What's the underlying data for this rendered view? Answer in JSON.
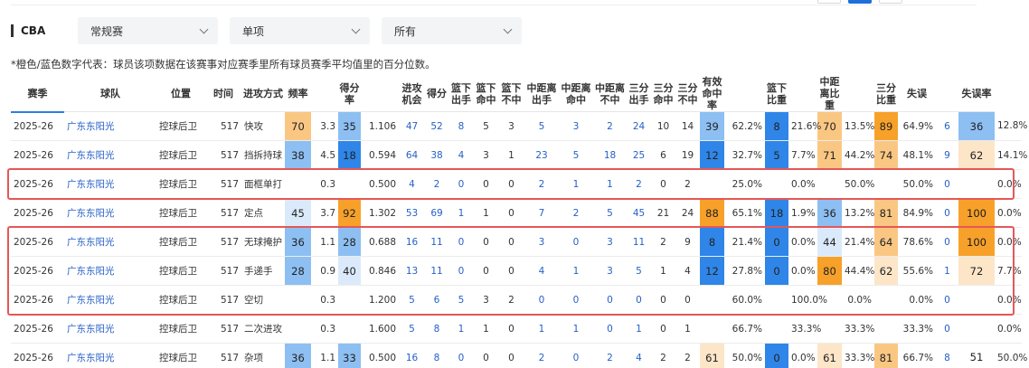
{
  "top_controls": [
    {
      "active": false
    },
    {
      "active": true
    },
    {
      "active": false
    }
  ],
  "league_label": "CBA",
  "filters": [
    {
      "label": "常规赛",
      "icon": "chevron-down-icon"
    },
    {
      "label": "单项",
      "icon": "chevron-down-icon"
    },
    {
      "label": "所有",
      "icon": "chevron-down-icon"
    }
  ],
  "note": "*橙色/蓝色数字代表：球员该项数据在该赛事对应赛季里所有球员赛季平均值里的百分位数。",
  "colors": {
    "blue_dark": "#2f86e8",
    "blue_mid": "#8dbff2",
    "blue_light": "#dbeafb",
    "orange_dark": "#f7a12a",
    "orange_mid": "#fac783",
    "orange_light": "#fde5c8",
    "link": "#2660c6",
    "highlight_border": "#e55757"
  },
  "columns": [
    "赛季",
    "球队",
    "位置",
    "时间",
    "进攻方式",
    "频率",
    "",
    "得分率",
    "",
    "进攻机会",
    "得分",
    "篮下出手",
    "篮下命中",
    "篮下不中",
    "中距离出手",
    "中距离命中",
    "中距离不中",
    "三分出手",
    "三分命中",
    "三分不中",
    "有效命中率",
    "",
    "篮下比重",
    "",
    "中距离比重",
    "",
    "三分比重",
    "失误",
    "",
    "失误率"
  ],
  "rows": [
    {
      "season": "2025-26",
      "team": "广东东阳光",
      "pos": "控球后卫",
      "time": "517",
      "type": "快攻",
      "freq_pct": "70",
      "freq_tone": "orange_mid",
      "freq": "3.3",
      "ppp_pct": "35",
      "ppp_tone": "blue_mid",
      "ppp": "1.106",
      "poss": "47",
      "pts": "52",
      "rim_att": "8",
      "rim_made": "5",
      "rim_miss": "3",
      "mid_att": "5",
      "mid_made": "3",
      "mid_miss": "2",
      "three_att": "24",
      "three_made": "10",
      "three_miss": "14",
      "efg_pct": "39",
      "efg_tone": "blue_mid",
      "efg": "62.2%",
      "rim_share_pct": "8",
      "rim_share_tone": "blue_dark",
      "rim_share": "21.6%",
      "mid_share_pct": "70",
      "mid_share_tone": "orange_mid",
      "mid_share": "13.5%",
      "three_share_pct": "89",
      "three_share_tone": "orange_dark",
      "three_share": "64.9%",
      "tov": "6",
      "tov_pct": "36",
      "tov_tone": "blue_mid",
      "tov_rate": "12.8%"
    },
    {
      "season": "2025-26",
      "team": "广东东阳光",
      "pos": "控球后卫",
      "time": "517",
      "type": "挡拆持球",
      "freq_pct": "38",
      "freq_tone": "blue_mid",
      "freq": "4.5",
      "ppp_pct": "18",
      "ppp_tone": "blue_dark",
      "ppp": "0.594",
      "poss": "64",
      "pts": "38",
      "rim_att": "4",
      "rim_made": "3",
      "rim_miss": "1",
      "mid_att": "23",
      "mid_made": "5",
      "mid_miss": "18",
      "three_att": "25",
      "three_made": "6",
      "three_miss": "19",
      "efg_pct": "12",
      "efg_tone": "blue_dark",
      "efg": "32.7%",
      "rim_share_pct": "5",
      "rim_share_tone": "blue_dark",
      "rim_share": "7.7%",
      "mid_share_pct": "71",
      "mid_share_tone": "orange_mid",
      "mid_share": "44.2%",
      "three_share_pct": "74",
      "three_share_tone": "orange_mid",
      "three_share": "48.1%",
      "tov": "9",
      "tov_pct": "62",
      "tov_tone": "orange_light",
      "tov_rate": "14.1%"
    },
    {
      "season": "2025-26",
      "team": "广东东阳光",
      "pos": "控球后卫",
      "time": "517",
      "type": "面框单打",
      "freq_pct": "",
      "freq_tone": "",
      "freq": "0.3",
      "ppp_pct": "",
      "ppp_tone": "",
      "ppp": "0.500",
      "poss": "4",
      "pts": "2",
      "rim_att": "0",
      "rim_made": "0",
      "rim_miss": "0",
      "mid_att": "2",
      "mid_made": "1",
      "mid_miss": "1",
      "three_att": "2",
      "three_made": "0",
      "three_miss": "2",
      "efg_pct": "",
      "efg_tone": "",
      "efg": "25.0%",
      "rim_share_pct": "",
      "rim_share_tone": "",
      "rim_share": "0.0%",
      "mid_share_pct": "",
      "mid_share_tone": "",
      "mid_share": "50.0%",
      "three_share_pct": "",
      "three_share_tone": "",
      "three_share": "50.0%",
      "tov": "0",
      "tov_pct": "",
      "tov_tone": "",
      "tov_rate": "0.0%"
    },
    {
      "season": "2025-26",
      "team": "广东东阳光",
      "pos": "控球后卫",
      "time": "517",
      "type": "定点",
      "freq_pct": "45",
      "freq_tone": "blue_light",
      "freq": "3.7",
      "ppp_pct": "92",
      "ppp_tone": "orange_dark",
      "ppp": "1.302",
      "poss": "53",
      "pts": "69",
      "rim_att": "1",
      "rim_made": "1",
      "rim_miss": "0",
      "mid_att": "7",
      "mid_made": "2",
      "mid_miss": "5",
      "three_att": "45",
      "three_made": "21",
      "three_miss": "24",
      "efg_pct": "88",
      "efg_tone": "orange_dark",
      "efg": "65.1%",
      "rim_share_pct": "18",
      "rim_share_tone": "blue_dark",
      "rim_share": "1.9%",
      "mid_share_pct": "36",
      "mid_share_tone": "blue_mid",
      "mid_share": "13.2%",
      "three_share_pct": "81",
      "three_share_tone": "orange_mid",
      "three_share": "84.9%",
      "tov": "0",
      "tov_pct": "100",
      "tov_tone": "orange_dark",
      "tov_rate": "0.0%"
    },
    {
      "season": "2025-26",
      "team": "广东东阳光",
      "pos": "控球后卫",
      "time": "517",
      "type": "无球掩护",
      "freq_pct": "36",
      "freq_tone": "blue_mid",
      "freq": "1.1",
      "ppp_pct": "28",
      "ppp_tone": "blue_mid",
      "ppp": "0.688",
      "poss": "16",
      "pts": "11",
      "rim_att": "0",
      "rim_made": "0",
      "rim_miss": "0",
      "mid_att": "3",
      "mid_made": "0",
      "mid_miss": "3",
      "three_att": "11",
      "three_made": "2",
      "three_miss": "9",
      "efg_pct": "8",
      "efg_tone": "blue_dark",
      "efg": "21.4%",
      "rim_share_pct": "0",
      "rim_share_tone": "blue_dark",
      "rim_share": "0.0%",
      "mid_share_pct": "44",
      "mid_share_tone": "blue_light",
      "mid_share": "21.4%",
      "three_share_pct": "64",
      "three_share_tone": "orange_mid",
      "three_share": "78.6%",
      "tov": "0",
      "tov_pct": "100",
      "tov_tone": "orange_dark",
      "tov_rate": "0.0%"
    },
    {
      "season": "2025-26",
      "team": "广东东阳光",
      "pos": "控球后卫",
      "time": "517",
      "type": "手递手",
      "freq_pct": "28",
      "freq_tone": "blue_mid",
      "freq": "0.9",
      "ppp_pct": "40",
      "ppp_tone": "blue_light",
      "ppp": "0.846",
      "poss": "13",
      "pts": "11",
      "rim_att": "0",
      "rim_made": "0",
      "rim_miss": "0",
      "mid_att": "4",
      "mid_made": "1",
      "mid_miss": "3",
      "three_att": "5",
      "three_made": "1",
      "three_miss": "4",
      "efg_pct": "12",
      "efg_tone": "blue_dark",
      "efg": "27.8%",
      "rim_share_pct": "0",
      "rim_share_tone": "blue_dark",
      "rim_share": "0.0%",
      "mid_share_pct": "80",
      "mid_share_tone": "orange_dark",
      "mid_share": "44.4%",
      "three_share_pct": "62",
      "three_share_tone": "orange_light",
      "three_share": "55.6%",
      "tov": "1",
      "tov_pct": "72",
      "tov_tone": "orange_light",
      "tov_rate": "7.7%"
    },
    {
      "season": "2025-26",
      "team": "广东东阳光",
      "pos": "控球后卫",
      "time": "517",
      "type": "空切",
      "freq_pct": "",
      "freq_tone": "",
      "freq": "0.3",
      "ppp_pct": "",
      "ppp_tone": "",
      "ppp": "1.200",
      "poss": "5",
      "pts": "6",
      "rim_att": "5",
      "rim_made": "3",
      "rim_miss": "2",
      "mid_att": "0",
      "mid_made": "0",
      "mid_miss": "0",
      "three_att": "0",
      "three_made": "0",
      "three_miss": "0",
      "efg_pct": "",
      "efg_tone": "",
      "efg": "60.0%",
      "rim_share_pct": "",
      "rim_share_tone": "",
      "rim_share": "100.0%",
      "mid_share_pct": "",
      "mid_share_tone": "",
      "mid_share": "0.0%",
      "three_share_pct": "",
      "three_share_tone": "",
      "three_share": "0.0%",
      "tov": "0",
      "tov_pct": "",
      "tov_tone": "",
      "tov_rate": "0.0%"
    },
    {
      "season": "2025-26",
      "team": "广东东阳光",
      "pos": "控球后卫",
      "time": "517",
      "type": "二次进攻",
      "freq_pct": "",
      "freq_tone": "",
      "freq": "0.3",
      "ppp_pct": "",
      "ppp_tone": "",
      "ppp": "1.600",
      "poss": "5",
      "pts": "8",
      "rim_att": "1",
      "rim_made": "1",
      "rim_miss": "0",
      "mid_att": "1",
      "mid_made": "1",
      "mid_miss": "0",
      "three_att": "1",
      "three_made": "0",
      "three_miss": "1",
      "efg_pct": "",
      "efg_tone": "",
      "efg": "66.7%",
      "rim_share_pct": "",
      "rim_share_tone": "",
      "rim_share": "33.3%",
      "mid_share_pct": "",
      "mid_share_tone": "",
      "mid_share": "33.3%",
      "three_share_pct": "",
      "three_share_tone": "",
      "three_share": "33.3%",
      "tov": "0",
      "tov_pct": "",
      "tov_tone": "",
      "tov_rate": "0.0%"
    },
    {
      "season": "2025-26",
      "team": "广东东阳光",
      "pos": "控球后卫",
      "time": "517",
      "type": "杂项",
      "freq_pct": "36",
      "freq_tone": "blue_mid",
      "freq": "1.1",
      "ppp_pct": "33",
      "ppp_tone": "blue_mid",
      "ppp": "0.500",
      "poss": "16",
      "pts": "8",
      "rim_att": "0",
      "rim_made": "0",
      "rim_miss": "0",
      "mid_att": "2",
      "mid_made": "0",
      "mid_miss": "2",
      "three_att": "4",
      "three_made": "2",
      "three_miss": "2",
      "efg_pct": "61",
      "efg_tone": "orange_light",
      "efg": "50.0%",
      "rim_share_pct": "0",
      "rim_share_tone": "blue_dark",
      "rim_share": "0.0%",
      "mid_share_pct": "61",
      "mid_share_tone": "orange_light",
      "mid_share": "33.3%",
      "three_share_pct": "81",
      "three_share_tone": "orange_mid",
      "three_share": "66.7%",
      "tov": "8",
      "tov_pct": "51",
      "tov_tone": "",
      "tov_rate": "50.0%"
    }
  ],
  "highlight_groups": [
    [
      2,
      2
    ],
    [
      4,
      6
    ]
  ]
}
